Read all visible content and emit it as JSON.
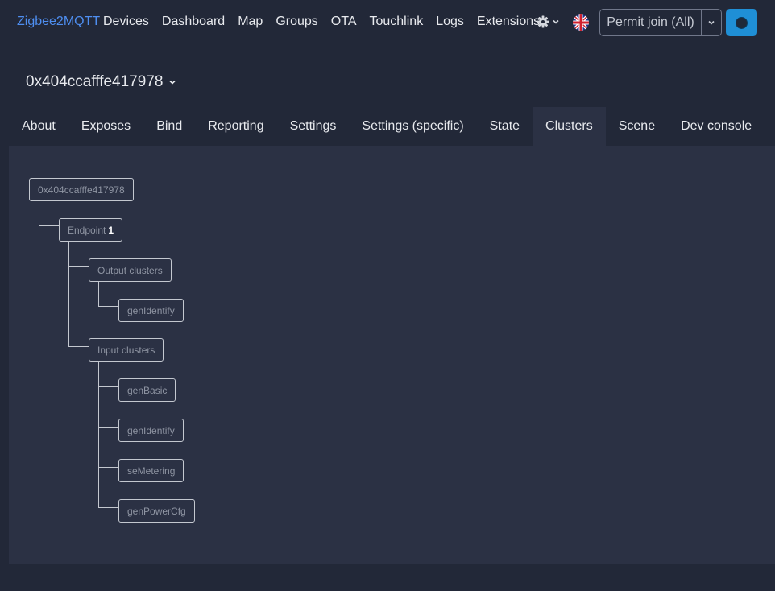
{
  "navbar": {
    "brand": "Zigbee2MQTT",
    "links": [
      "Devices",
      "Dashboard",
      "Map",
      "Groups",
      "OTA",
      "Touchlink",
      "Logs",
      "Extensions"
    ],
    "settings_icon": "gear-icon",
    "language_icon": "uk-flag-icon",
    "permit_join_label": "Permit join (All)",
    "status_button_icon": "status-dot-icon",
    "accent_color": "#4e8ef0",
    "status_button_color": "#1f8fd6"
  },
  "device": {
    "title": "0x404ccafffe417978"
  },
  "tabs": [
    "About",
    "Exposes",
    "Bind",
    "Reporting",
    "Settings",
    "Settings (specific)",
    "State",
    "Clusters",
    "Scene",
    "Dev console"
  ],
  "active_tab": "Clusters",
  "tree": {
    "root": "0x404ccafffe417978",
    "endpoint_label": "Endpoint",
    "endpoint_id": "1",
    "output_label": "Output clusters",
    "output_clusters": [
      "genIdentify"
    ],
    "input_label": "Input clusters",
    "input_clusters": [
      "genBasic",
      "genIdentify",
      "seMetering",
      "genPowerCfg"
    ]
  }
}
